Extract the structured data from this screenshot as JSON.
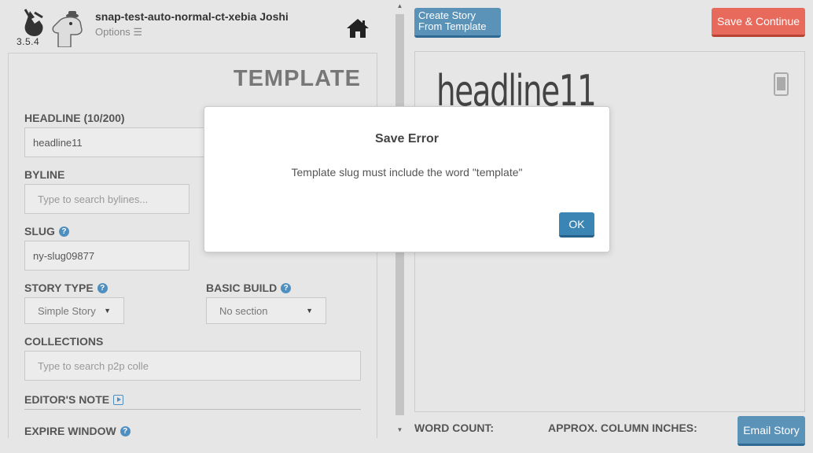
{
  "header": {
    "version": "3.5.4",
    "user_name": "snap-test-auto-normal-ct-xebia Joshi",
    "options_label": "Options ☰"
  },
  "form": {
    "title": "TEMPLATE",
    "headline_label": "HEADLINE (10/200)",
    "headline_value": "headline11",
    "byline_label": "BYLINE",
    "byline_placeholder": "Type to search bylines...",
    "slug_label": "SLUG",
    "slug_value": "ny-slug09877",
    "story_type_label": "STORY TYPE",
    "story_type_value": "Simple Story",
    "basic_build_label": "BASIC BUILD",
    "basic_build_value": "No section",
    "collections_label": "COLLECTIONS",
    "collections_placeholder": "Type to search p2p colle",
    "editors_note_label": "EDITOR'S NOTE",
    "expire_window_label": "EXPIRE WINDOW"
  },
  "toolbar": {
    "create_from_template_line1": "Create Story",
    "create_from_template_line2": "From Template",
    "save_continue": "Save & Continue",
    "email_story": "Email Story"
  },
  "preview": {
    "headline": "headline11"
  },
  "footer": {
    "word_count_label": "WORD COUNT:",
    "column_inches_label": "APPROX. COLUMN INCHES:"
  },
  "modal": {
    "title": "Save Error",
    "message": "Template slug must include the word \"template\"",
    "ok_label": "OK"
  }
}
